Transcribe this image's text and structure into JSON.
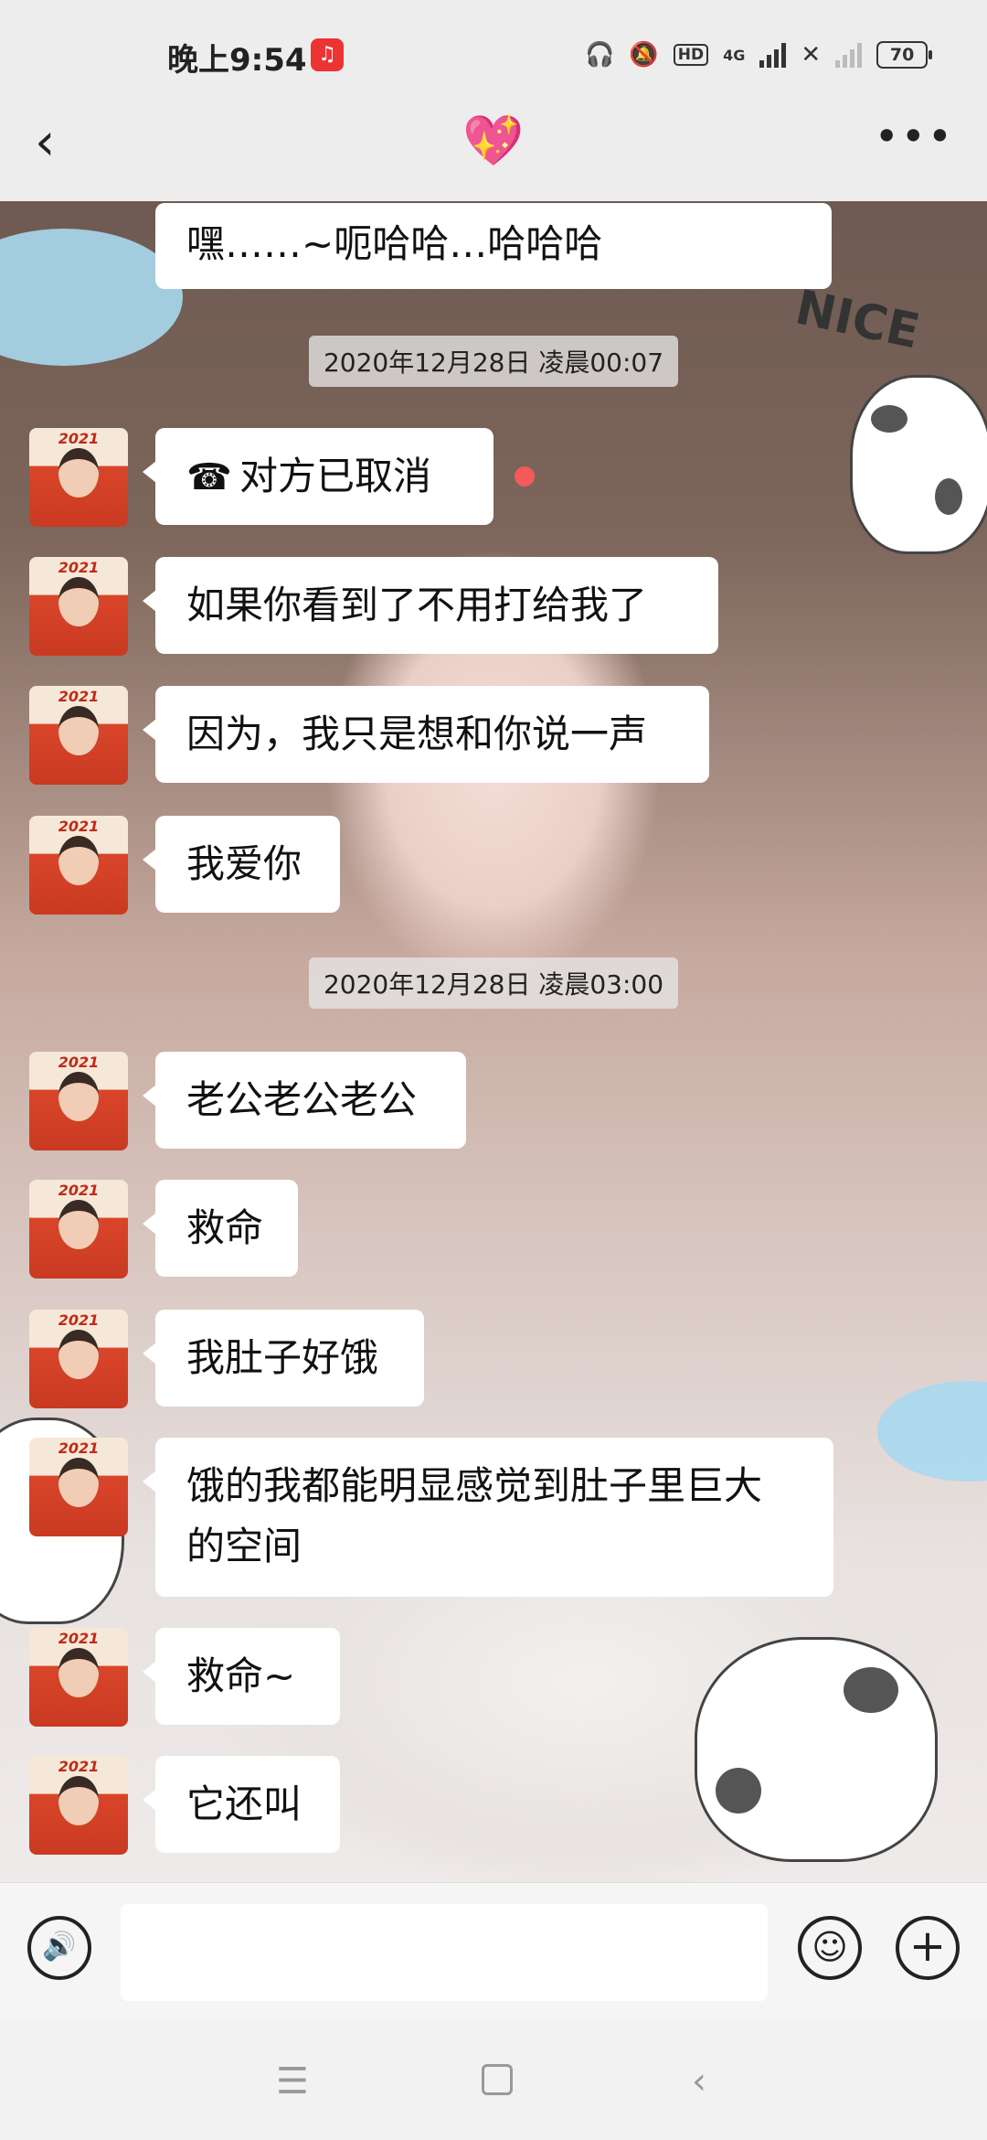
{
  "status_bar": {
    "time": "晚上9:54",
    "app_badge": "♫",
    "hd": "HD",
    "network": "4G",
    "battery": "70"
  },
  "header": {
    "back_icon": "‹",
    "title": "💖",
    "more_icon": "•••"
  },
  "background": {
    "sticker_text": "NICE"
  },
  "messages": [
    {
      "text": "嘿……~呃哈哈…哈哈哈"
    },
    {
      "text": "对方已取消",
      "call_icon": "☎"
    },
    {
      "text": "如果你看到了不用打给我了"
    },
    {
      "text": "因为，我只是想和你说一声"
    },
    {
      "text": "我爱你"
    },
    {
      "text": "老公老公老公"
    },
    {
      "text": "救命"
    },
    {
      "text": "我肚子好饿"
    },
    {
      "text_line1": "饿的我都能明显感觉到肚子里巨大",
      "text_line2": "的空间"
    },
    {
      "text": "救命~"
    },
    {
      "text": "它还叫"
    }
  ],
  "timestamps": [
    {
      "text": "2020年12月28日 凌晨00:07"
    },
    {
      "text": "2020年12月28日 凌晨03:00"
    }
  ],
  "avatar": {
    "year_text": "2021"
  },
  "input_bar": {
    "voice_icon": "🔊",
    "emoji_icon": "☺",
    "plus_icon": "+",
    "placeholder": ""
  },
  "system_nav": {
    "menu_icon": "☰",
    "back_icon": "‹"
  }
}
